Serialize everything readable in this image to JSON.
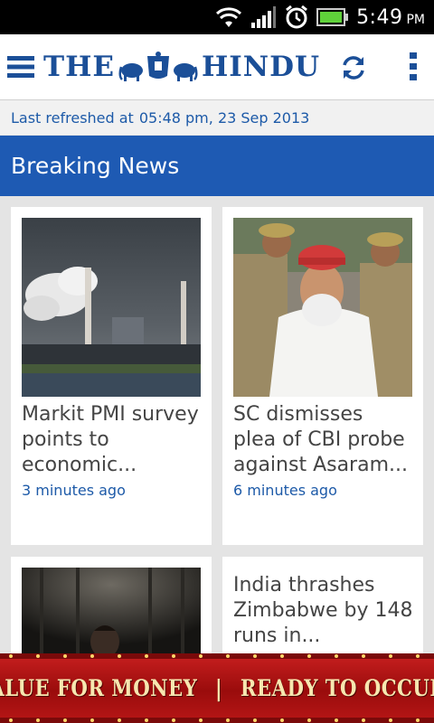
{
  "status_bar": {
    "time": "5:49",
    "ampm": "PM",
    "icons": [
      "wifi-icon",
      "signal-icon",
      "alarm-icon",
      "battery-icon"
    ]
  },
  "app_bar": {
    "logo_left": "THE",
    "logo_right": "HINDU",
    "icons": [
      "menu-icon",
      "refresh-icon",
      "overflow-menu-icon"
    ]
  },
  "refresh": {
    "label": "Last refreshed at",
    "timestamp": "05:48 pm, 23 Sep 2013"
  },
  "section": {
    "title": "Breaking News"
  },
  "articles": [
    {
      "title_lines": [
        "Markit PMI survey",
        "points to",
        "economic..."
      ],
      "age": "3 minutes ago",
      "image": "industrial-chimneys-photo"
    },
    {
      "title_lines": [
        "SC dismisses",
        "plea of CBI probe",
        "against Asaram..."
      ],
      "age": "6 minutes ago",
      "image": "man-in-red-cap-photo"
    },
    {
      "title_lines": [],
      "age": "",
      "image": "dark-stage-photo"
    },
    {
      "title_lines": [
        "India thrashes",
        "Zimbabwe by 148",
        "runs in..."
      ],
      "age": "",
      "image": ""
    }
  ],
  "ad": {
    "left": "VALUE FOR MONEY",
    "separator": "|",
    "right": "READY TO OCCUPY"
  },
  "colors": {
    "brand_blue": "#1b4f98",
    "section_blue": "#1e5ab3",
    "link_blue": "#1d5aa8",
    "ad_red": "#b31515"
  }
}
